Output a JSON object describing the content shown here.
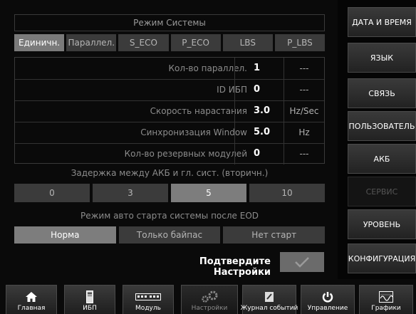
{
  "title": "Режим Системы",
  "modes": [
    "Единичн.",
    "Параллел.",
    "S_ECO",
    "P_ECO",
    "LBS",
    "P_LBS"
  ],
  "active_mode": 0,
  "params": [
    {
      "label": "Кол-во параллел.",
      "value": "1",
      "unit": "---"
    },
    {
      "label": "ID ИБП",
      "value": "0",
      "unit": "---"
    },
    {
      "label": "Скорость нарастания",
      "value": "3.0",
      "unit": "Hz/Sec"
    },
    {
      "label": "Синхронизация Window",
      "value": "5.0",
      "unit": "Hz"
    },
    {
      "label": "Кол-во резервных модулей",
      "value": "0",
      "unit": "---"
    }
  ],
  "delay": {
    "label": "Задержка между АКБ и гл. сист. (вторичн.)",
    "options": [
      "0",
      "3",
      "5",
      "10"
    ],
    "active": 2
  },
  "autostart": {
    "label": "Режим авто старта системы после EOD",
    "options": [
      "Норма",
      "Только байпас",
      "Нет старт"
    ],
    "active": 0
  },
  "confirm_label": "Подтвердите Настройки",
  "right_menu": [
    {
      "label": "ДАТА И ВРЕМЯ",
      "enabled": true
    },
    {
      "label": "ЯЗЫК",
      "enabled": true
    },
    {
      "label": "СВЯЗЬ",
      "enabled": true
    },
    {
      "label": "ПОЛЬЗОВАТЕЛЬ",
      "enabled": true
    },
    {
      "label": "АКБ",
      "enabled": true
    },
    {
      "label": "СЕРВИС",
      "enabled": false
    },
    {
      "label": "УРОВЕНЬ",
      "enabled": true
    },
    {
      "label": "КОНФИГУРАЦИЯ",
      "enabled": true
    }
  ],
  "bottom_tabs": [
    {
      "label": "Главная",
      "icon": "home-icon"
    },
    {
      "label": "ИБП",
      "icon": "ups-icon"
    },
    {
      "label": "Модуль",
      "icon": "module-icon"
    },
    {
      "label": "Настройки",
      "icon": "gears-icon"
    },
    {
      "label": "Журнал событий",
      "icon": "log-icon"
    },
    {
      "label": "Управление",
      "icon": "power-icon"
    },
    {
      "label": "Графики",
      "icon": "chart-icon"
    }
  ],
  "active_tab": 3
}
